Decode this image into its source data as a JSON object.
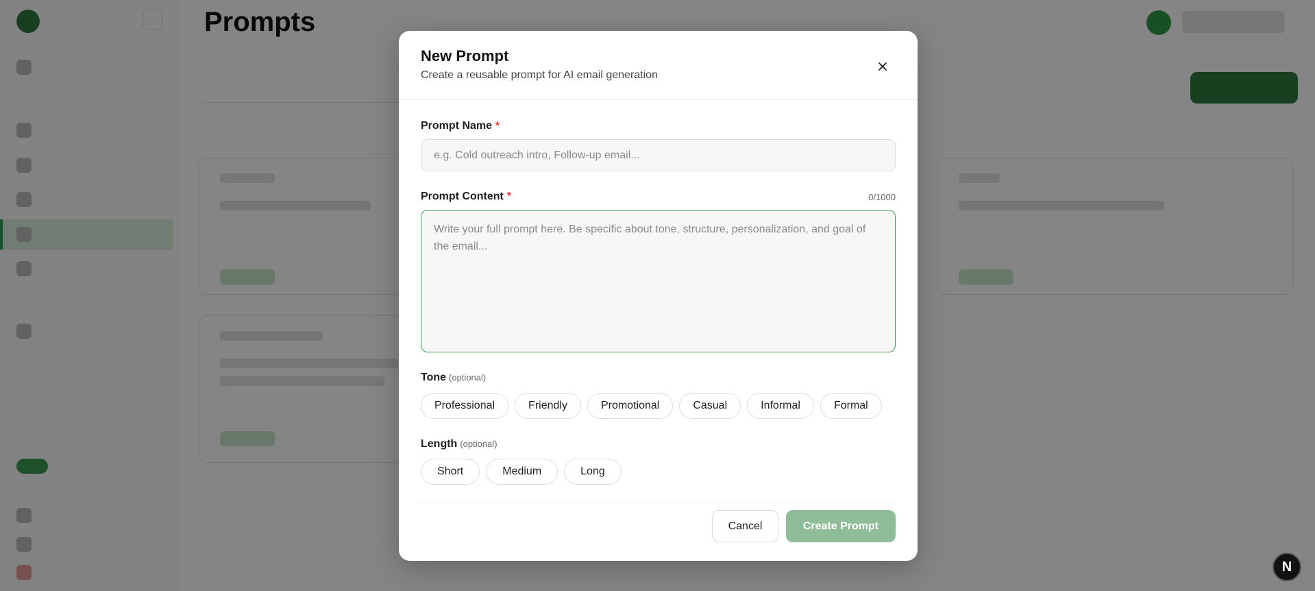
{
  "background": {
    "page_title": "Prompts"
  },
  "modal": {
    "title": "New Prompt",
    "subtitle": "Create a reusable prompt for AI email generation",
    "prompt_name": {
      "label": "Prompt Name",
      "required_mark": "*",
      "value": "",
      "placeholder": "e.g. Cold outreach intro, Follow-up email..."
    },
    "prompt_content": {
      "label": "Prompt Content",
      "required_mark": "*",
      "counter": "0/1000",
      "value": "",
      "placeholder": "Write your full prompt here. Be specific about tone, structure, personalization, and goal of the email..."
    },
    "tone": {
      "label": "Tone",
      "optional": "(optional)",
      "options": [
        "Professional",
        "Friendly",
        "Promotional",
        "Casual",
        "Informal",
        "Formal"
      ]
    },
    "length": {
      "label": "Length",
      "optional": "(optional)",
      "options": [
        "Short",
        "Medium",
        "Long"
      ]
    },
    "cancel_label": "Cancel",
    "create_label": "Create Prompt"
  },
  "fab_label": "N",
  "colors": {
    "accent": "#3a9a52",
    "create_button_disabled": "#8fbd9a",
    "required": "#d93b3b"
  }
}
